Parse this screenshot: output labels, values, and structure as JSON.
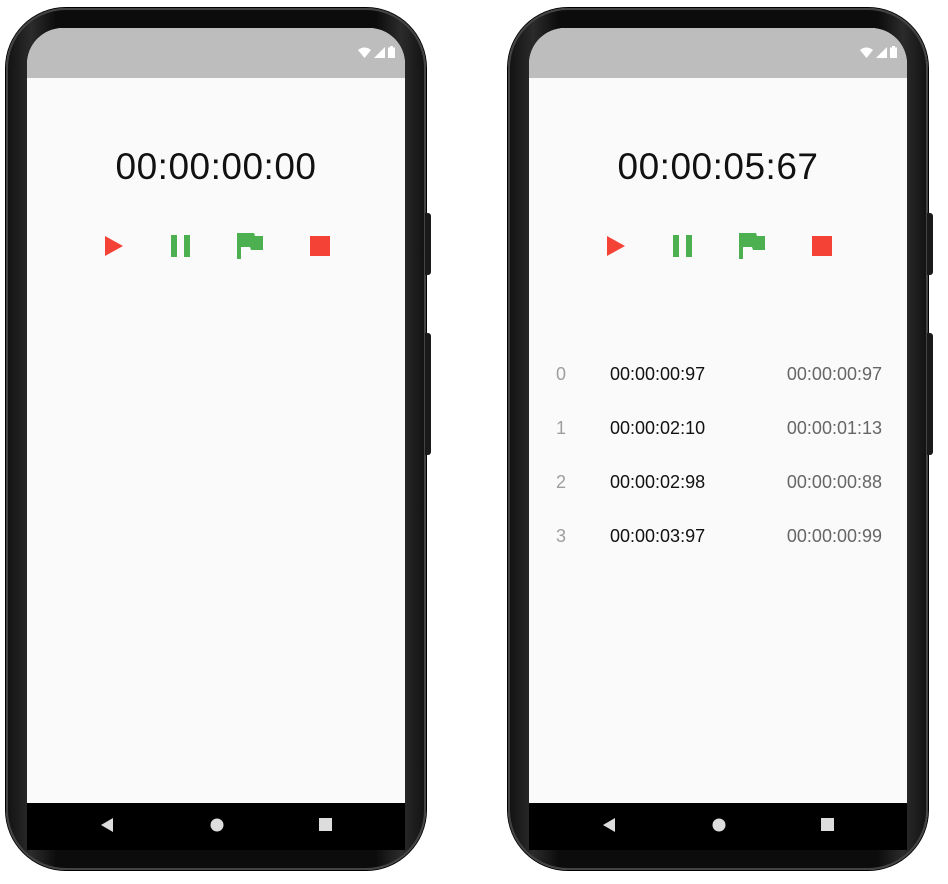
{
  "theme": {
    "play_color": "#f44336",
    "pause_color": "#4caf50",
    "flag_color": "#4caf50",
    "stop_color": "#f44336",
    "statusbar_color": "#bdbdbd",
    "screen_bg": "#fafafa"
  },
  "status_icons": [
    "wifi-icon",
    "signal-icon",
    "battery-icon"
  ],
  "controls": [
    "play-icon",
    "pause-icon",
    "flag-icon",
    "stop-icon"
  ],
  "nav_icons": [
    "back-icon",
    "home-icon",
    "recents-icon"
  ],
  "phone_left": {
    "timer": "00:00:00:00",
    "laps": []
  },
  "phone_right": {
    "timer": "00:00:05:67",
    "laps": [
      {
        "index": "0",
        "total": "00:00:00:97",
        "split": "00:00:00:97"
      },
      {
        "index": "1",
        "total": "00:00:02:10",
        "split": "00:00:01:13"
      },
      {
        "index": "2",
        "total": "00:00:02:98",
        "split": "00:00:00:88"
      },
      {
        "index": "3",
        "total": "00:00:03:97",
        "split": "00:00:00:99"
      }
    ]
  }
}
